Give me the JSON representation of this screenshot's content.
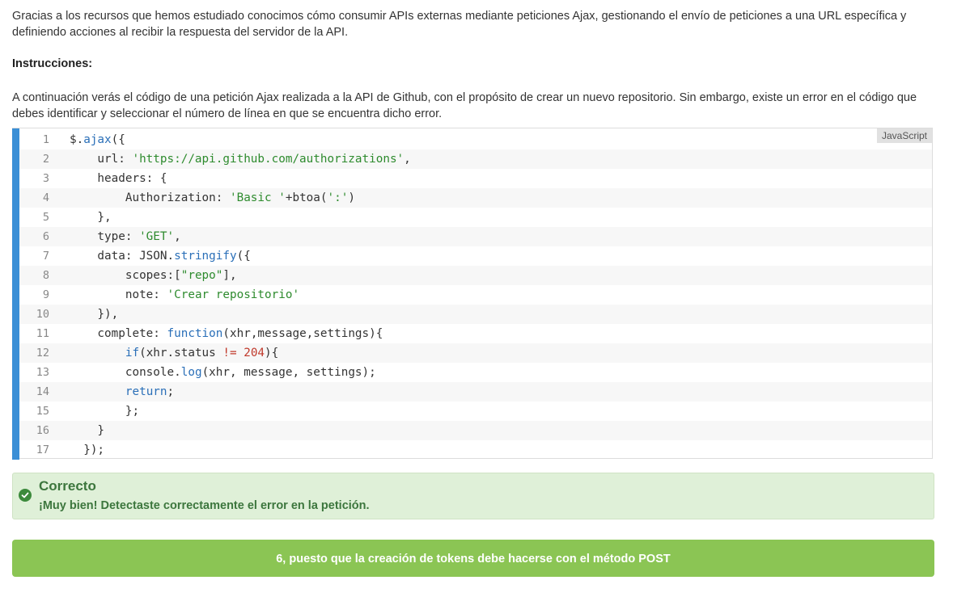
{
  "intro": "Gracias a los recursos que hemos estudiado conocimos cómo consumir APIs externas mediante peticiones Ajax, gestionando el envío de peticiones a una URL específica y definiendo acciones al recibir la respuesta del servidor de la API.",
  "instructions": {
    "title": "Instrucciones:",
    "text": "A continuación verás el código de una petición Ajax realizada a la API de Github, con el propósito de crear un nuevo repositorio. Sin embargo, existe un error en el código que debes identificar y seleccionar el número de línea en que se encuentra dicho error."
  },
  "code": {
    "language": "JavaScript",
    "accent_color": "#3b8fd6",
    "lines": [
      {
        "n": "1",
        "text": "$.ajax({"
      },
      {
        "n": "2",
        "text": "    url: 'https://api.github.com/authorizations',"
      },
      {
        "n": "3",
        "text": "    headers: {"
      },
      {
        "n": "4",
        "text": "        Authorization: 'Basic '+btoa(':')"
      },
      {
        "n": "5",
        "text": "    },"
      },
      {
        "n": "6",
        "text": "    type: 'GET',"
      },
      {
        "n": "7",
        "text": "    data: JSON.stringify({"
      },
      {
        "n": "8",
        "text": "        scopes:[\"repo\"],"
      },
      {
        "n": "9",
        "text": "        note: 'Crear repositorio'"
      },
      {
        "n": "10",
        "text": "    }),"
      },
      {
        "n": "11",
        "text": "    complete: function(xhr,message,settings){"
      },
      {
        "n": "12",
        "text": "        if(xhr.status != 204){"
      },
      {
        "n": "13",
        "text": "        console.log(xhr, message, settings);"
      },
      {
        "n": "14",
        "text": "        return;"
      },
      {
        "n": "15",
        "text": "        };"
      },
      {
        "n": "16",
        "text": "    }"
      },
      {
        "n": "17",
        "text": "  });"
      }
    ]
  },
  "feedback": {
    "icon": "check-circle-icon",
    "title": "Correcto",
    "message": "¡Muy bien! Detectaste correctamente el error en la petición.",
    "color": "#3c763d",
    "background": "#dff0d8"
  },
  "answer": {
    "label": "6, puesto que la creación de tokens debe hacerse con el método POST",
    "color": "#8bc554"
  }
}
